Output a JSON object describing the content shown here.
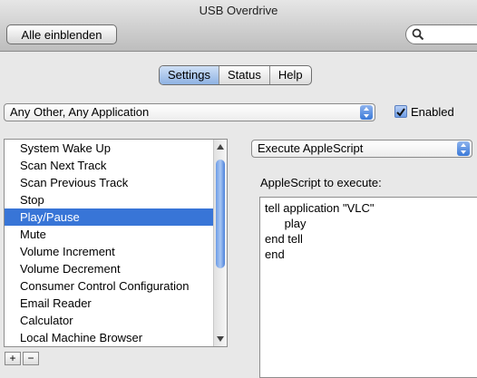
{
  "window": {
    "title": "USB Overdrive"
  },
  "toolbar": {
    "show_all_label": "Alle einblenden",
    "search_placeholder": ""
  },
  "tabs": [
    {
      "label": "Settings",
      "active": true
    },
    {
      "label": "Status",
      "active": false
    },
    {
      "label": "Help",
      "active": false
    }
  ],
  "app_selector": {
    "value": "Any Other, Any Application"
  },
  "enabled": {
    "label": "Enabled",
    "checked": true
  },
  "event_list": {
    "items": [
      "System Wake Up",
      "Scan Next Track",
      "Scan Previous Track",
      "Stop",
      "Play/Pause",
      "Mute",
      "Volume Increment",
      "Volume Decrement",
      "Consumer Control Configuration",
      "Email Reader",
      "Calculator",
      "Local Machine Browser"
    ],
    "selected_index": 4,
    "add_label": "+",
    "remove_label": "−"
  },
  "action": {
    "selector_value": "Execute AppleScript",
    "script_label": "AppleScript to execute:",
    "script_lines": [
      "tell application \"VLC\"",
      "      play",
      "end tell",
      "end"
    ]
  },
  "colors": {
    "selection": "#3875d7",
    "accent": "#6e9de6"
  }
}
